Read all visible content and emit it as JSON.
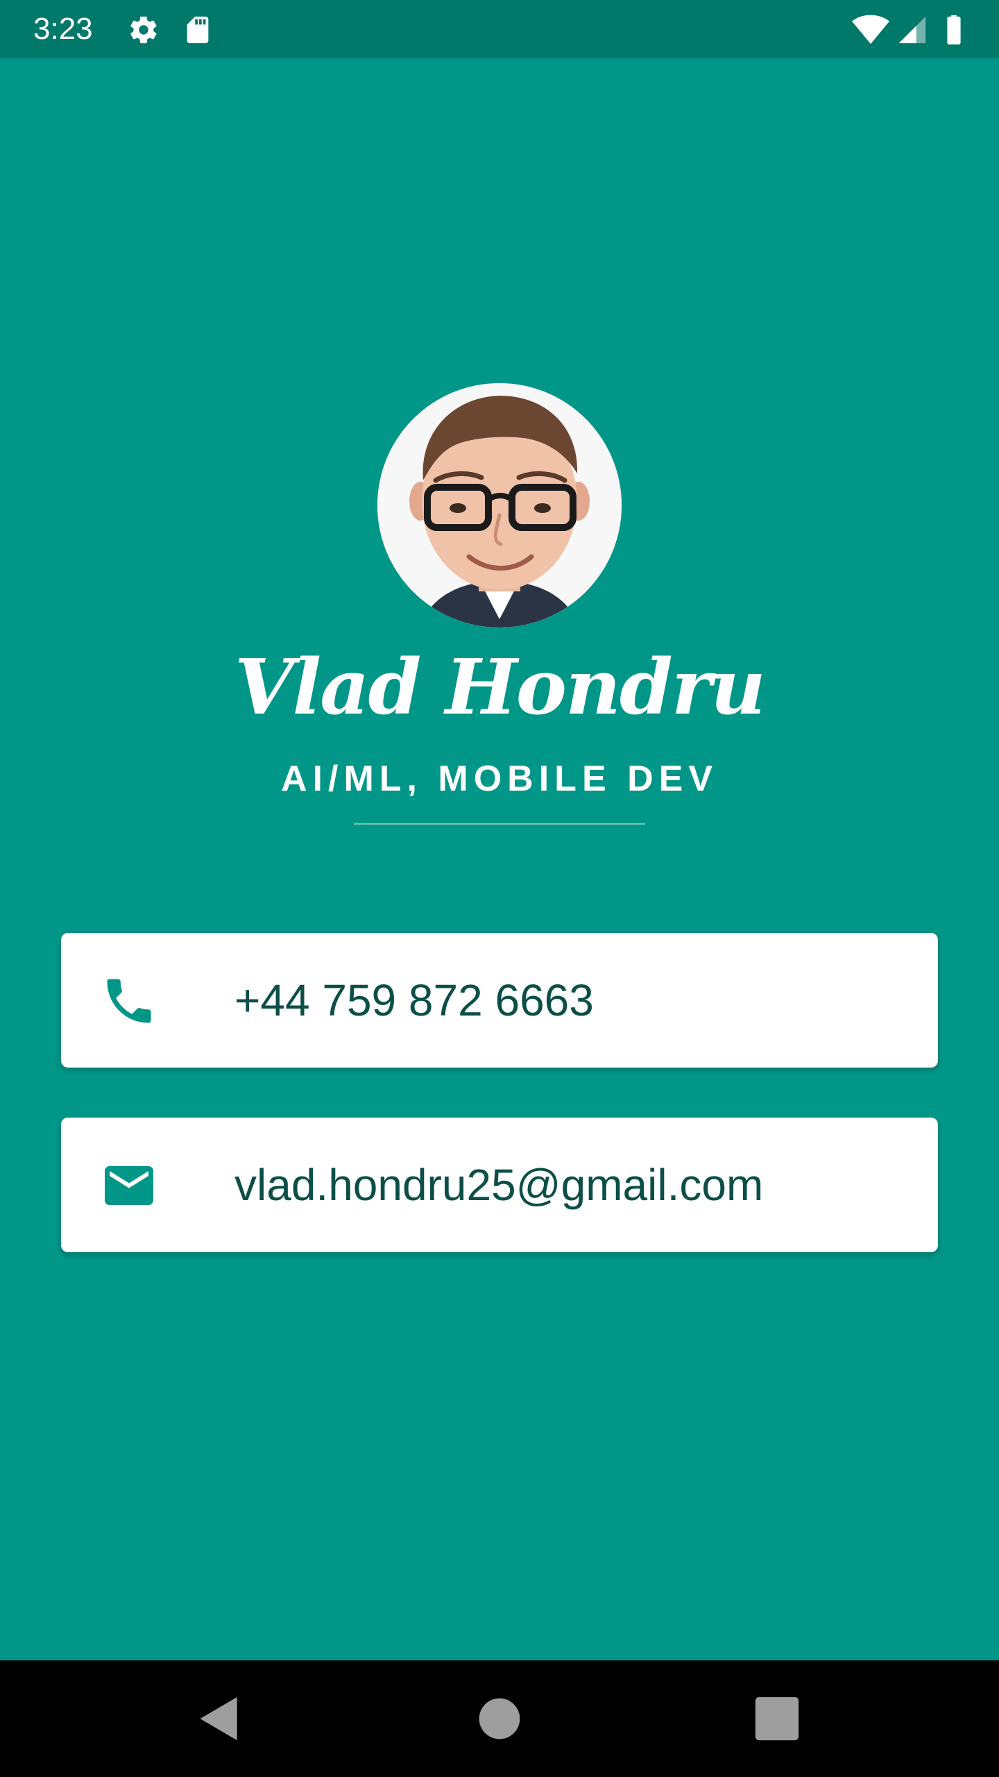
{
  "status_bar": {
    "time": "3:23",
    "icons": [
      "gear-icon",
      "sd-card-icon",
      "wifi-icon",
      "cell-signal-icon",
      "battery-icon"
    ]
  },
  "profile": {
    "name": "Vlad Hondru",
    "title": "AI/ML, MOBILE DEV"
  },
  "contacts": {
    "phone": {
      "icon": "phone-icon",
      "value": "+44 759 872 6663"
    },
    "email": {
      "icon": "mail-icon",
      "value": "vlad.hondru25@gmail.com"
    }
  },
  "nav": {
    "icons": [
      "back-icon",
      "home-icon",
      "recents-icon"
    ]
  },
  "colors": {
    "background": "#009688",
    "status_bar": "#00796b",
    "card": "#ffffff",
    "card_text": "#0b4f47",
    "icon": "#009688"
  }
}
